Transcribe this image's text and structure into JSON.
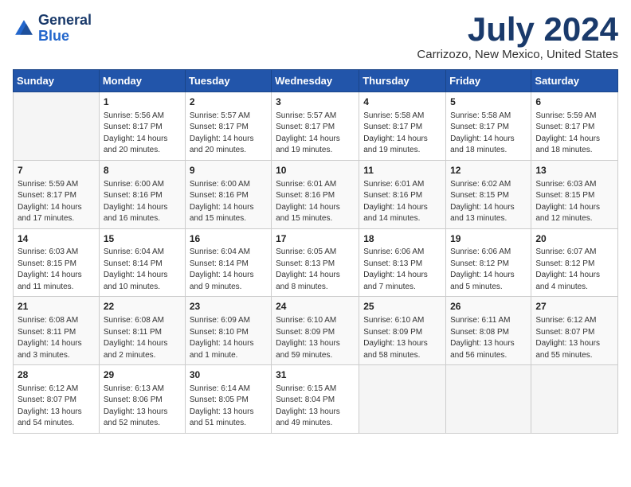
{
  "header": {
    "logo_line1": "General",
    "logo_line2": "Blue",
    "month": "July 2024",
    "location": "Carrizozo, New Mexico, United States"
  },
  "weekdays": [
    "Sunday",
    "Monday",
    "Tuesday",
    "Wednesday",
    "Thursday",
    "Friday",
    "Saturday"
  ],
  "weeks": [
    [
      {
        "day": "",
        "info": ""
      },
      {
        "day": "1",
        "info": "Sunrise: 5:56 AM\nSunset: 8:17 PM\nDaylight: 14 hours\nand 20 minutes."
      },
      {
        "day": "2",
        "info": "Sunrise: 5:57 AM\nSunset: 8:17 PM\nDaylight: 14 hours\nand 20 minutes."
      },
      {
        "day": "3",
        "info": "Sunrise: 5:57 AM\nSunset: 8:17 PM\nDaylight: 14 hours\nand 19 minutes."
      },
      {
        "day": "4",
        "info": "Sunrise: 5:58 AM\nSunset: 8:17 PM\nDaylight: 14 hours\nand 19 minutes."
      },
      {
        "day": "5",
        "info": "Sunrise: 5:58 AM\nSunset: 8:17 PM\nDaylight: 14 hours\nand 18 minutes."
      },
      {
        "day": "6",
        "info": "Sunrise: 5:59 AM\nSunset: 8:17 PM\nDaylight: 14 hours\nand 18 minutes."
      }
    ],
    [
      {
        "day": "7",
        "info": "Sunrise: 5:59 AM\nSunset: 8:17 PM\nDaylight: 14 hours\nand 17 minutes."
      },
      {
        "day": "8",
        "info": "Sunrise: 6:00 AM\nSunset: 8:16 PM\nDaylight: 14 hours\nand 16 minutes."
      },
      {
        "day": "9",
        "info": "Sunrise: 6:00 AM\nSunset: 8:16 PM\nDaylight: 14 hours\nand 15 minutes."
      },
      {
        "day": "10",
        "info": "Sunrise: 6:01 AM\nSunset: 8:16 PM\nDaylight: 14 hours\nand 15 minutes."
      },
      {
        "day": "11",
        "info": "Sunrise: 6:01 AM\nSunset: 8:16 PM\nDaylight: 14 hours\nand 14 minutes."
      },
      {
        "day": "12",
        "info": "Sunrise: 6:02 AM\nSunset: 8:15 PM\nDaylight: 14 hours\nand 13 minutes."
      },
      {
        "day": "13",
        "info": "Sunrise: 6:03 AM\nSunset: 8:15 PM\nDaylight: 14 hours\nand 12 minutes."
      }
    ],
    [
      {
        "day": "14",
        "info": "Sunrise: 6:03 AM\nSunset: 8:15 PM\nDaylight: 14 hours\nand 11 minutes."
      },
      {
        "day": "15",
        "info": "Sunrise: 6:04 AM\nSunset: 8:14 PM\nDaylight: 14 hours\nand 10 minutes."
      },
      {
        "day": "16",
        "info": "Sunrise: 6:04 AM\nSunset: 8:14 PM\nDaylight: 14 hours\nand 9 minutes."
      },
      {
        "day": "17",
        "info": "Sunrise: 6:05 AM\nSunset: 8:13 PM\nDaylight: 14 hours\nand 8 minutes."
      },
      {
        "day": "18",
        "info": "Sunrise: 6:06 AM\nSunset: 8:13 PM\nDaylight: 14 hours\nand 7 minutes."
      },
      {
        "day": "19",
        "info": "Sunrise: 6:06 AM\nSunset: 8:12 PM\nDaylight: 14 hours\nand 5 minutes."
      },
      {
        "day": "20",
        "info": "Sunrise: 6:07 AM\nSunset: 8:12 PM\nDaylight: 14 hours\nand 4 minutes."
      }
    ],
    [
      {
        "day": "21",
        "info": "Sunrise: 6:08 AM\nSunset: 8:11 PM\nDaylight: 14 hours\nand 3 minutes."
      },
      {
        "day": "22",
        "info": "Sunrise: 6:08 AM\nSunset: 8:11 PM\nDaylight: 14 hours\nand 2 minutes."
      },
      {
        "day": "23",
        "info": "Sunrise: 6:09 AM\nSunset: 8:10 PM\nDaylight: 14 hours\nand 1 minute."
      },
      {
        "day": "24",
        "info": "Sunrise: 6:10 AM\nSunset: 8:09 PM\nDaylight: 13 hours\nand 59 minutes."
      },
      {
        "day": "25",
        "info": "Sunrise: 6:10 AM\nSunset: 8:09 PM\nDaylight: 13 hours\nand 58 minutes."
      },
      {
        "day": "26",
        "info": "Sunrise: 6:11 AM\nSunset: 8:08 PM\nDaylight: 13 hours\nand 56 minutes."
      },
      {
        "day": "27",
        "info": "Sunrise: 6:12 AM\nSunset: 8:07 PM\nDaylight: 13 hours\nand 55 minutes."
      }
    ],
    [
      {
        "day": "28",
        "info": "Sunrise: 6:12 AM\nSunset: 8:07 PM\nDaylight: 13 hours\nand 54 minutes."
      },
      {
        "day": "29",
        "info": "Sunrise: 6:13 AM\nSunset: 8:06 PM\nDaylight: 13 hours\nand 52 minutes."
      },
      {
        "day": "30",
        "info": "Sunrise: 6:14 AM\nSunset: 8:05 PM\nDaylight: 13 hours\nand 51 minutes."
      },
      {
        "day": "31",
        "info": "Sunrise: 6:15 AM\nSunset: 8:04 PM\nDaylight: 13 hours\nand 49 minutes."
      },
      {
        "day": "",
        "info": ""
      },
      {
        "day": "",
        "info": ""
      },
      {
        "day": "",
        "info": ""
      }
    ]
  ]
}
